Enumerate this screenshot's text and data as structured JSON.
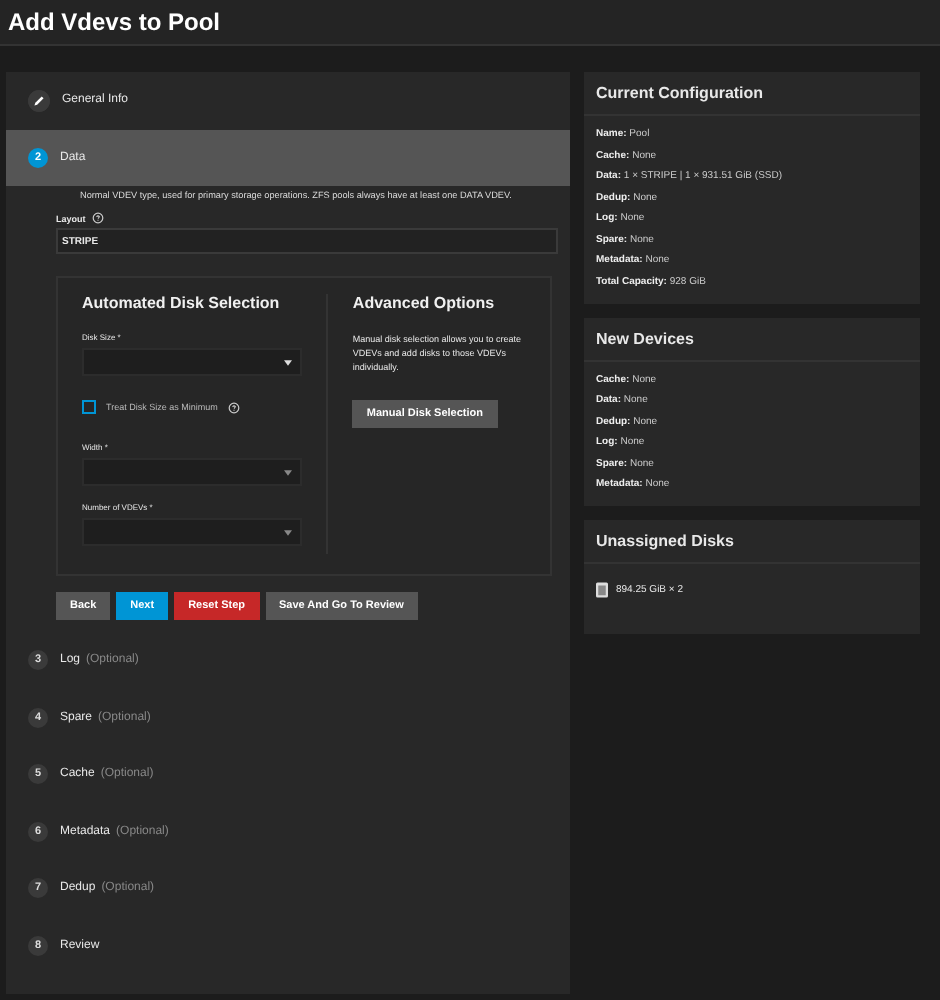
{
  "title": "Add Vdevs to Pool",
  "steps": [
    {
      "kind": "done",
      "label": "General Info",
      "selected": false
    },
    {
      "kind": "number",
      "number": "2",
      "label": "Data",
      "selected": true
    },
    {
      "kind": "number",
      "number": "3",
      "label": "Log",
      "optional": "(Optional)",
      "selected": false
    },
    {
      "kind": "number",
      "number": "4",
      "label": "Spare",
      "optional": "(Optional)",
      "selected": false
    },
    {
      "kind": "number",
      "number": "5",
      "label": "Cache",
      "optional": "(Optional)",
      "selected": false
    },
    {
      "kind": "number",
      "number": "6",
      "label": "Metadata",
      "optional": "(Optional)",
      "selected": false
    },
    {
      "kind": "number",
      "number": "7",
      "label": "Dedup",
      "optional": "(Optional)",
      "selected": false
    },
    {
      "kind": "number",
      "number": "8",
      "label": "Review",
      "selected": false
    }
  ],
  "data_step": {
    "description": "Normal VDEV type, used for primary storage operations. ZFS pools always have at least one DATA VDEV.",
    "layout": {
      "label": "Layout",
      "value": "STRIPE"
    },
    "automated": {
      "title": "Automated Disk Selection",
      "selects": [
        {
          "label": "Disk Size *"
        },
        {
          "label": "Width *"
        },
        {
          "label": "Number of VDEVs *"
        }
      ],
      "checkbox": {
        "label": "Treat Disk Size as Minimum",
        "checked": false
      }
    },
    "advanced": {
      "title": "Advanced Options",
      "text": "Manual disk selection allows you to create VDEVs and add disks to those VDEVs individually.",
      "button": "Manual Disk Selection"
    },
    "buttons": [
      {
        "label": "Back",
        "kind": "plain"
      },
      {
        "label": "Next",
        "kind": "primary"
      },
      {
        "label": "Reset Step",
        "kind": "danger"
      },
      {
        "label": "Save And Go To Review",
        "kind": "plain"
      }
    ]
  },
  "current_configuration": {
    "title": "Current Configuration",
    "rows": [
      {
        "key": "Name:",
        "value": "Pool"
      },
      {
        "key": "Cache:",
        "value": "None"
      },
      {
        "key": "Data:",
        "value": "1 × STRIPE | 1 × 931.51 GiB (SSD)"
      },
      {
        "key": "Dedup:",
        "value": "None"
      },
      {
        "key": "Log:",
        "value": "None"
      },
      {
        "key": "Spare:",
        "value": "None"
      },
      {
        "key": "Metadata:",
        "value": "None"
      },
      {
        "key": "Total Capacity:",
        "value": "928 GiB"
      }
    ]
  },
  "new_devices": {
    "title": "New Devices",
    "rows": [
      {
        "key": "Cache:",
        "value": "None"
      },
      {
        "key": "Data:",
        "value": "None"
      },
      {
        "key": "Dedup:",
        "value": "None"
      },
      {
        "key": "Log:",
        "value": "None"
      },
      {
        "key": "Spare:",
        "value": "None"
      },
      {
        "key": "Metadata:",
        "value": "None"
      }
    ]
  },
  "unassigned_disks": {
    "title": "Unassigned Disks",
    "items": [
      {
        "text": "894.25 GiB × 2"
      }
    ]
  }
}
